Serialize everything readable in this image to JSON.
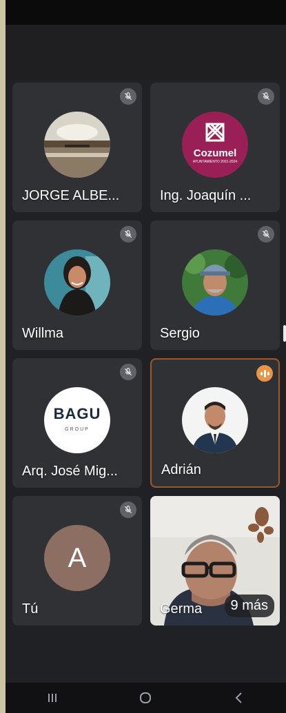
{
  "app": {
    "colors": {
      "background": "#202124",
      "tile": "#303134",
      "muted_badge": "#5f6368",
      "speaking_border": "#a0582a",
      "speaking_badge": "#e8954a",
      "cozumel_brand": "#9a1f56",
      "avatar_letter_bg": "#8d6e63"
    }
  },
  "participants": [
    {
      "name": "JORGE ALBE...",
      "muted": true,
      "avatar": "sunset-photo"
    },
    {
      "name": "Ing. Joaquín ...",
      "muted": true,
      "avatar": "cozumel-logo",
      "logo_text": "Cozumel",
      "logo_subtext": "AYUNTAMIENTO 2021-2024"
    },
    {
      "name": "Willma",
      "muted": true,
      "avatar": "woman-photo"
    },
    {
      "name": "Sergio",
      "muted": true,
      "avatar": "man-cap-photo"
    },
    {
      "name": "Arq. José Mig...",
      "muted": true,
      "avatar": "bagu-logo",
      "logo_text": "BAGU",
      "logo_subtext": "GROUP"
    },
    {
      "name": "Adrián",
      "muted": false,
      "speaking": true,
      "avatar": "man-suit-photo"
    },
    {
      "name": "Tú",
      "muted": true,
      "avatar": "letter",
      "letter": "A"
    },
    {
      "name": "Germa",
      "muted": false,
      "avatar": "video-feed"
    }
  ],
  "overflow": {
    "more_label": "9 más"
  },
  "navigation": {
    "buttons": [
      "recent-apps-icon",
      "home-icon",
      "back-icon"
    ]
  }
}
